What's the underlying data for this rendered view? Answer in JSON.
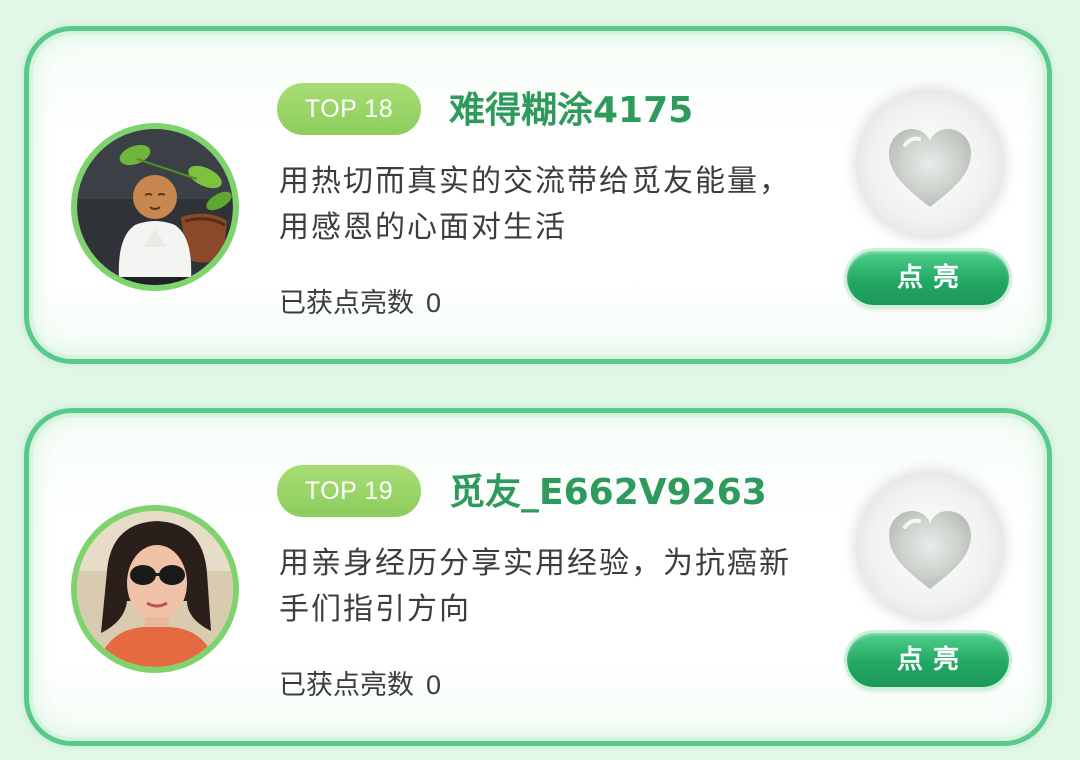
{
  "cards": [
    {
      "rank": "TOP 18",
      "username": "难得糊涂4175",
      "motto": "用热切而真实的交流带给觅友能量，用感恩的心面对生活",
      "likes_label": "已获点亮数",
      "likes_count": "0",
      "button_label": "点亮",
      "avatar_icon": "monk-figurine-avatar"
    },
    {
      "rank": "TOP 19",
      "username": "觅友_E662V9263",
      "motto": "用亲身经历分享实用经验，为抗癌新手们指引方向",
      "likes_label": "已获点亮数",
      "likes_count": "0",
      "button_label": "点亮",
      "avatar_icon": "woman-sunglasses-avatar"
    }
  ],
  "colors": {
    "background": "#e3f7e8",
    "card_border": "#58c88d",
    "username": "#2e9a5b",
    "rank_badge": "#98d466",
    "button": "#22a964"
  }
}
